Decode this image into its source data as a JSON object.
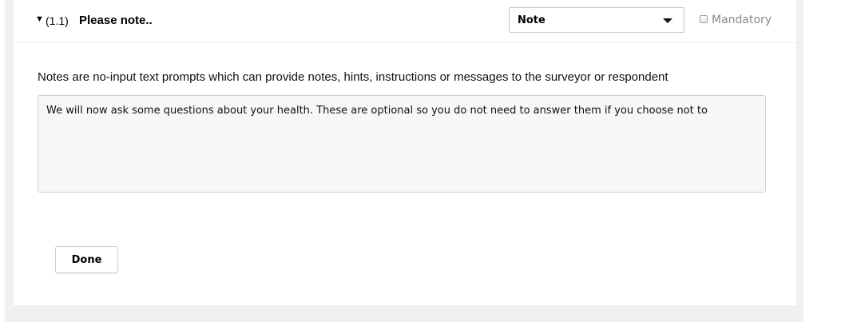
{
  "question": {
    "toggle_glyph": "▼",
    "number": "(1.1)",
    "title": "Please note.."
  },
  "type_select": {
    "selected": "Note"
  },
  "mandatory": {
    "label": "Mandatory",
    "checked": false
  },
  "description": "Notes are no-input text prompts which can provide notes, hints, instructions or messages to the surveyor or respondent",
  "note_text": "We will now ask some questions about your health. These are optional so you do not need to answer them if you choose not to",
  "done_label": "Done",
  "colors": {
    "page_bg": "#f0f0f0",
    "card_bg": "#ffffff",
    "textarea_bg": "#f7f7f7",
    "muted_text": "#8a8a8a"
  }
}
